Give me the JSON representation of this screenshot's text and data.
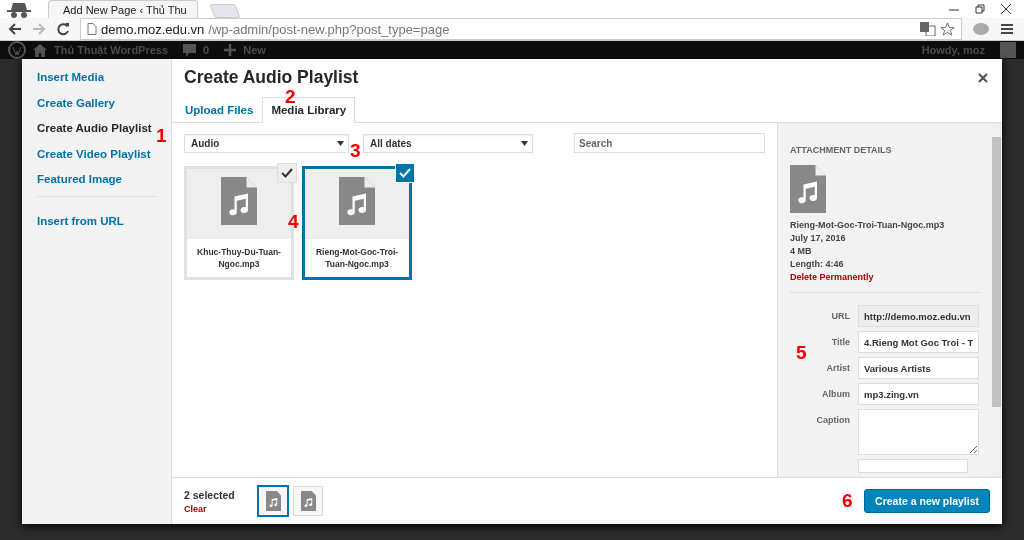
{
  "browser": {
    "tab_title": "Add New Page ‹ Thủ Thu",
    "url_host": "demo.moz.edu.vn",
    "url_path": "/wp-admin/post-new.php?post_type=page"
  },
  "admin_bar": {
    "site_name": "Thủ Thuật WordPress",
    "comments": "0",
    "new": "New",
    "greeting": "Howdy, moz"
  },
  "media_menu": {
    "items": [
      {
        "label": "Insert Media",
        "selected": false
      },
      {
        "label": "Create Gallery",
        "selected": false
      },
      {
        "label": "Create Audio Playlist",
        "selected": true
      },
      {
        "label": "Create Video Playlist",
        "selected": false
      },
      {
        "label": "Featured Image",
        "selected": false
      }
    ],
    "extra_items": [
      {
        "label": "Insert from URL",
        "selected": false
      }
    ]
  },
  "modal": {
    "title": "Create Audio Playlist",
    "tabs": [
      {
        "label": "Upload Files",
        "selected": false
      },
      {
        "label": "Media Library",
        "selected": true
      }
    ],
    "type_filter": "Audio",
    "date_filter": "All dates",
    "search": {
      "placeholder": "Search"
    },
    "attachments": [
      {
        "name": "Khuc-Thuy-Du-Tuan-Ngoc.mp3",
        "selected": true,
        "current": false
      },
      {
        "name": "Rieng-Mot-Goc-Troi-Tuan-Ngoc.mp3",
        "selected": true,
        "current": true
      }
    ]
  },
  "details": {
    "heading": "ATTACHMENT DETAILS",
    "filename": "Rieng-Mot-Goc-Troi-Tuan-Ngoc.mp3",
    "date": "July 17, 2016",
    "size": "4 MB",
    "length": "Length: 4:46",
    "delete": "Delete Permanently",
    "fields": [
      {
        "label": "URL",
        "value": "http://demo.moz.edu.vn",
        "kind": "readonly"
      },
      {
        "label": "Title",
        "value": "4.Rieng Mot Goc Troi - T",
        "kind": "text"
      },
      {
        "label": "Artist",
        "value": "Various Artists",
        "kind": "text"
      },
      {
        "label": "Album",
        "value": "mp3.zing.vn",
        "kind": "text"
      },
      {
        "label": "Caption",
        "kind": "textarea"
      }
    ]
  },
  "toolbar": {
    "count": "2 selected",
    "clear": "Clear",
    "selection": [
      {
        "current": true
      },
      {
        "current": false
      }
    ],
    "button": "Create a new playlist"
  },
  "annotations": [
    "1",
    "2",
    "3",
    "4",
    "5",
    "6"
  ]
}
